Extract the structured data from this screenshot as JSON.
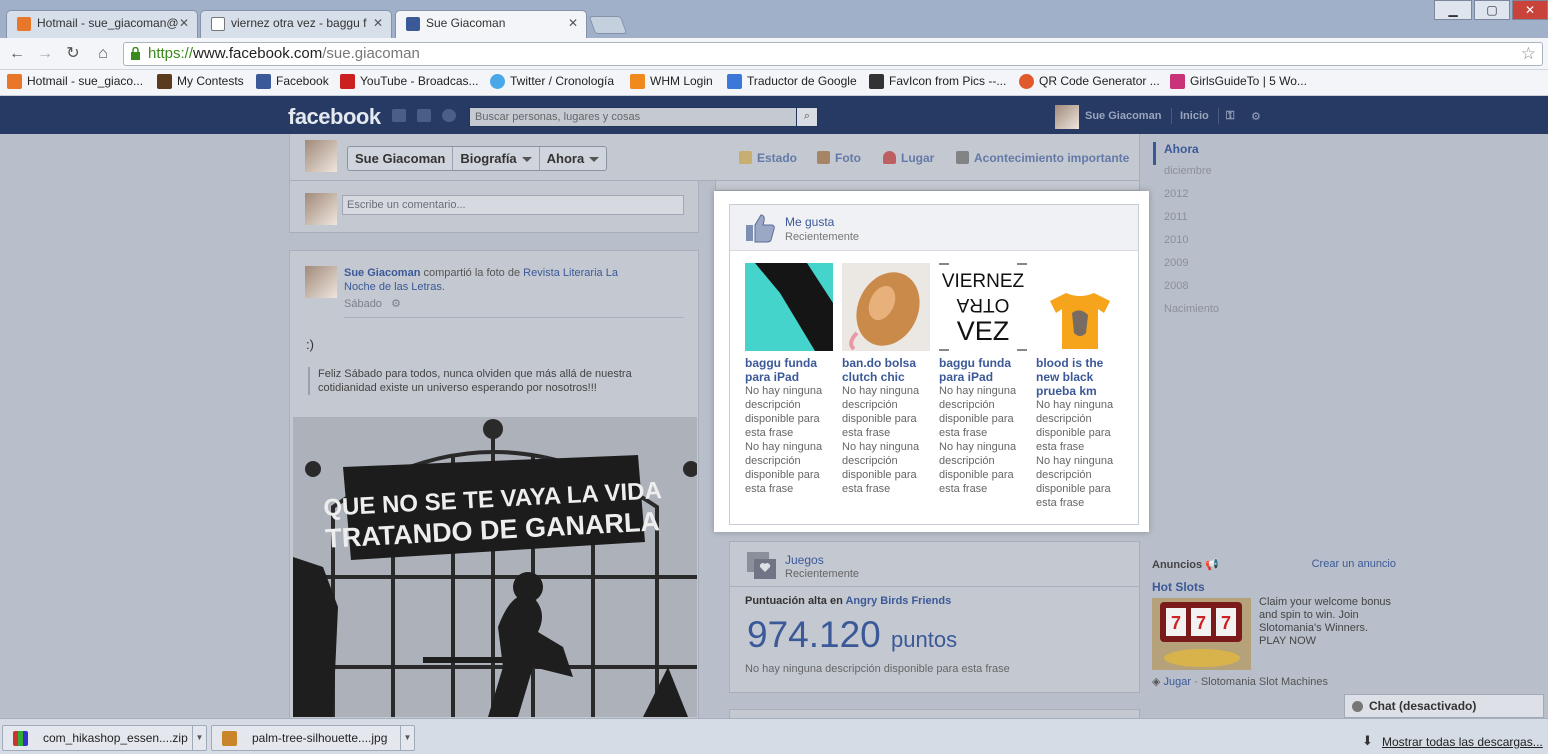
{
  "browser": {
    "tabs": [
      {
        "title": "Hotmail - sue_giacoman@",
        "active": false
      },
      {
        "title": "viernez otra vez - baggu f",
        "active": false
      },
      {
        "title": "Sue Giacoman",
        "active": true
      }
    ],
    "url_scheme": "https://",
    "url_host": "www.facebook.com",
    "url_path": "/sue.giacoman",
    "bookmarks": [
      "Hotmail - sue_giaco...",
      "My Contests",
      "Facebook",
      "YouTube - Broadcas...",
      "Twitter / Cronología",
      "WHM Login",
      "Traductor de Google",
      "FavIcon from Pics --...",
      "QR Code Generator ...",
      "GirlsGuideTo | 5 Wo..."
    ]
  },
  "facebook": {
    "logo": "facebook",
    "search_placeholder": "Buscar personas, lugares y cosas",
    "user_name": "Sue Giacoman",
    "home": "Inicio"
  },
  "timeline": {
    "name_button": "Sue Giacoman",
    "biografia": "Biografía",
    "ahora": "Ahora",
    "actions": {
      "estado": "Estado",
      "foto": "Foto",
      "lugar": "Lugar",
      "acontecimiento": "Acontecimiento importante"
    },
    "years": [
      "Ahora",
      "diciembre",
      "2012",
      "2011",
      "2010",
      "2009",
      "2008",
      "Nacimiento"
    ]
  },
  "comment": {
    "placeholder": "Escribe un comentario..."
  },
  "post": {
    "author": "Sue Giacoman",
    "action": "compartió la foto de",
    "page": "Revista Literaria La Noche de las Letras",
    "time": "Sábado",
    "smile": ":)",
    "quote": "Feliz Sábado para todos, nunca olviden que más allá de nuestra cotidianidad existe un universo esperando por nosotros!!!",
    "image_line1": "QUE NO SE TE VAYA LA VIDA",
    "image_line2": "TRATANDO DE GANARLA"
  },
  "likes": {
    "title": "Me gusta",
    "subtitle": "Recientemente",
    "viernez_art": [
      "VIERNEZ",
      "OTRA",
      "VEZ"
    ],
    "items": [
      {
        "name_l1": "baggu funda",
        "name_l2": "para iPad",
        "name_l3": "",
        "desc1": "No hay ninguna descripción disponible para esta frase",
        "desc2": "No hay ninguna descripción disponible para esta frase"
      },
      {
        "name_l1": "ban.do bolsa",
        "name_l2": "clutch chic",
        "name_l3": "",
        "desc1": "No hay ninguna descripción disponible para esta frase",
        "desc2": "No hay ninguna descripción disponible para esta frase"
      },
      {
        "name_l1": "baggu funda",
        "name_l2": "para iPad",
        "name_l3": "",
        "desc1": "No hay ninguna descripción disponible para esta frase",
        "desc2": "No hay ninguna descripción disponible para esta frase"
      },
      {
        "name_l1": "blood is the",
        "name_l2": "new black",
        "name_l3": "prueba km",
        "desc1": "No hay ninguna descripción disponible para esta frase",
        "desc2": "No hay ninguna descripción disponible para esta frase"
      }
    ]
  },
  "games": {
    "title": "Juegos",
    "subtitle": "Recientemente",
    "score_label": "Puntuación alta en",
    "game": "Angry Birds Friends",
    "score": "974.120",
    "score_unit": "puntos",
    "desc": "No hay ninguna descripción disponible para esta frase"
  },
  "ads": {
    "heading": "Anuncios",
    "create": "Crear un anuncio",
    "title": "Hot Slots",
    "text": "Claim your welcome bonus and spin to win. Join Slotomania's Winners. PLAY NOW",
    "play": "Jugar",
    "app": "· Slotomania Slot Machines"
  },
  "chat": {
    "label": "Chat (desactivado)"
  },
  "downloads": {
    "items": [
      "com_hikashop_essen....zip",
      "palm-tree-silhouette....jpg"
    ],
    "show_all": "Mostrar todas las descargas..."
  }
}
